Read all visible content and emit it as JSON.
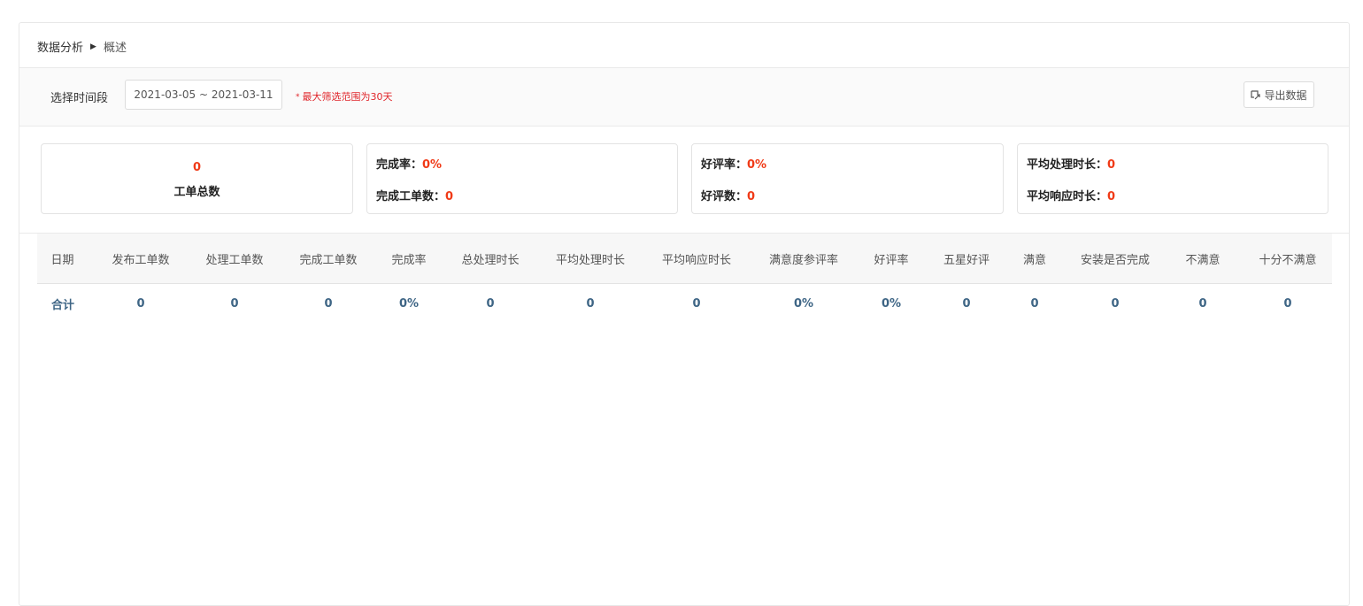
{
  "breadcrumb": {
    "parent": "数据分析",
    "current": "概述"
  },
  "filter": {
    "label": "选择时间段",
    "date_range": "2021-03-05 ~ 2021-03-11",
    "hint_star": "*",
    "hint": "最大筛选范围为30天",
    "export_label": "导出数据"
  },
  "cards": {
    "total": {
      "value": "0",
      "label": "工单总数"
    },
    "completion": {
      "rate_label": "完成率：",
      "rate_value": "0%",
      "count_label": "完成工单数：",
      "count_value": "0"
    },
    "praise": {
      "rate_label": "好评率：",
      "rate_value": "0%",
      "count_label": "好评数：",
      "count_value": "0"
    },
    "duration": {
      "process_label": "平均处理时长：",
      "process_value": "0",
      "response_label": "平均响应时长：",
      "response_value": "0"
    }
  },
  "table": {
    "headers": [
      "日期",
      "发布工单数",
      "处理工单数",
      "完成工单数",
      "完成率",
      "总处理时长",
      "平均处理时长",
      "平均响应时长",
      "满意度参评率",
      "好评率",
      "五星好评",
      "满意",
      "安装是否完成",
      "不满意",
      "十分不满意"
    ],
    "total_row": [
      "合计",
      "0",
      "0",
      "0",
      "0%",
      "0",
      "0",
      "0",
      "0%",
      "0%",
      "0",
      "0",
      "0",
      "0",
      "0"
    ]
  },
  "colors": {
    "accent_red": "#f03a17",
    "total_text": "#3e6585"
  }
}
